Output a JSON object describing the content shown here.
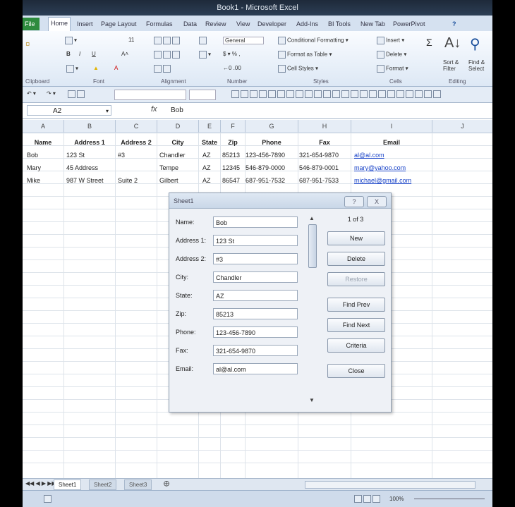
{
  "window": {
    "title": "Book1 - Microsoft Excel"
  },
  "ribbon_tabs": [
    "File",
    "Home",
    "Insert",
    "Page Layout",
    "Formulas",
    "Data",
    "Review",
    "View",
    "Developer",
    "Add-Ins",
    "BI Tools",
    "New Tab",
    "PowerPivot"
  ],
  "active_tab": "Home",
  "ribbon": {
    "clipboard_label": "Clipboard",
    "font_label": "Font",
    "alignment_label": "Alignment",
    "number_label": "Number",
    "styles_label": "Styles",
    "cells_label": "Cells",
    "editing_label": "Editing",
    "number_format": "General",
    "conditional_formatting": "Conditional Formatting",
    "format_as_table": "Format as Table",
    "cell_styles": "Cell Styles",
    "insert": "Insert",
    "delete": "Delete",
    "format": "Format",
    "sort_filter": "Sort & Filter",
    "find_select": "Find & Select",
    "font_size": "11"
  },
  "formula_bar": {
    "name_box": "A2",
    "fx": "fx",
    "value": "Bob"
  },
  "columns": [
    "A",
    "B",
    "C",
    "D",
    "E",
    "F",
    "G",
    "H",
    "I",
    "J"
  ],
  "headers": [
    "Name",
    "Address 1",
    "Address 2",
    "City",
    "State",
    "Zip",
    "Phone",
    "Fax",
    "Email"
  ],
  "rows": [
    [
      "Bob",
      "123 St",
      "#3",
      "Chandler",
      "AZ",
      "85213",
      "123-456-7890",
      "321-654-9870",
      "al@al.com"
    ],
    [
      "Mary",
      "45 Address",
      "",
      "Tempe",
      "AZ",
      "12345",
      "546-879-0000",
      "546-879-0001",
      "mary@yahoo.com"
    ],
    [
      "Mike",
      "987 W Street",
      "Suite 2",
      "Gilbert",
      "AZ",
      "86547",
      "687-951-7532",
      "687-951-7533",
      "michael@gmail.com"
    ]
  ],
  "sheet_tabs": [
    "Sheet1",
    "Sheet2",
    "Sheet3"
  ],
  "active_sheet": "Sheet1",
  "status": {
    "zoom": "100%"
  },
  "dialog": {
    "title": "Sheet1",
    "help_button": "?",
    "close_button": "X",
    "record_count": "1 of 3",
    "fields": [
      {
        "label": "Name:",
        "value": "Bob"
      },
      {
        "label": "Address 1:",
        "value": "123 St"
      },
      {
        "label": "Address 2:",
        "value": "#3"
      },
      {
        "label": "City:",
        "value": "Chandler"
      },
      {
        "label": "State:",
        "value": "AZ"
      },
      {
        "label": "Zip:",
        "value": "85213"
      },
      {
        "label": "Phone:",
        "value": "123-456-7890"
      },
      {
        "label": "Fax:",
        "value": "321-654-9870"
      },
      {
        "label": "Email:",
        "value": "al@al.com"
      }
    ],
    "buttons": {
      "new": "New",
      "delete": "Delete",
      "restore": "Restore",
      "find_prev": "Find Prev",
      "find_next": "Find Next",
      "criteria": "Criteria",
      "close": "Close"
    }
  }
}
